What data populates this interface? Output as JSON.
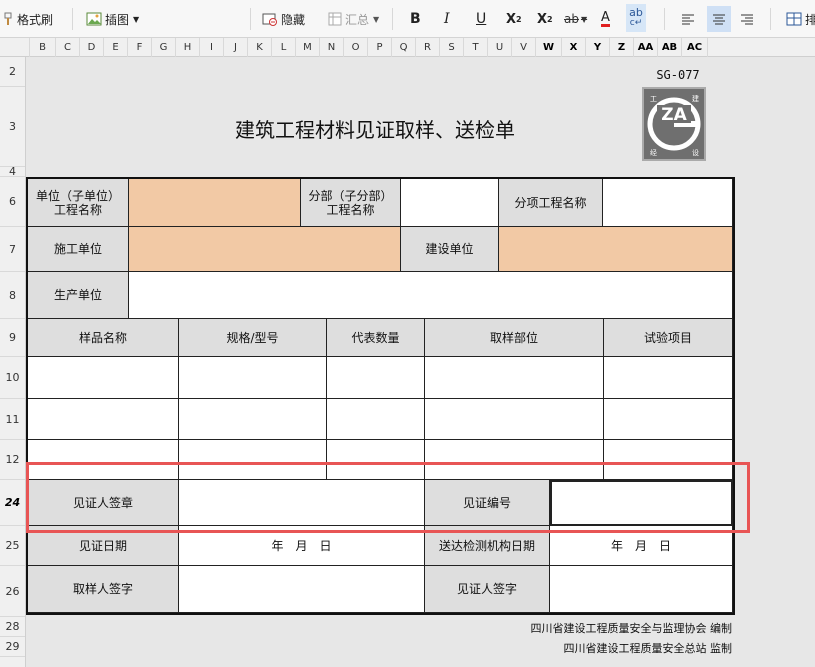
{
  "toolbar": {
    "format_painter": "格式刷",
    "insert_image": "插图",
    "hide": "隐藏",
    "summary": "汇总",
    "bold": "B",
    "italic": "I",
    "underline": "U",
    "superscript": "X",
    "subscript": "X",
    "strike": "ab",
    "font_color": "A",
    "phonetic": "ab",
    "cut_label": "排"
  },
  "columns": [
    "B",
    "C",
    "D",
    "E",
    "F",
    "G",
    "H",
    "I",
    "J",
    "K",
    "L",
    "M",
    "N",
    "O",
    "P",
    "Q",
    "R",
    "S",
    "T",
    "U",
    "V",
    "W",
    "X",
    "Y",
    "Z",
    "AA",
    "AB",
    "AC"
  ],
  "rows": [
    "2",
    "3",
    "4",
    "6",
    "7",
    "8",
    "9",
    "10",
    "11",
    "12",
    "24",
    "25",
    "26",
    "28",
    "29"
  ],
  "sheet": {
    "doc_code": "SG-077",
    "title": "建筑工程材料见证取样、送检单",
    "logo": {
      "text": "ZA",
      "corners": [
        "工",
        "建",
        "经",
        "设"
      ]
    },
    "labels": {
      "unit_name": "单位（子单位）\n工程名称",
      "sub_division": "分部（子分部）\n工程名称",
      "sub_item": "分项工程名称",
      "construction_unit": "施工单位",
      "builder_unit": "建设单位",
      "producer": "生产单位",
      "sample_name": "样品名称",
      "spec_model": "规格/型号",
      "quantity": "代表数量",
      "sample_location": "取样部位",
      "test_item": "试验项目",
      "witness_seal": "见证人签章",
      "witness_no": "见证编号",
      "witness_date": "见证日期",
      "date_placeholder": "年　月　日",
      "send_date": "送达检测机构日期",
      "date_placeholder2": "年　月　日",
      "sampler_sign": "取样人签字",
      "witness_sign": "见证人签字"
    },
    "footer1": "四川省建设工程质量安全与监理协会  编制",
    "footer2": "四川省建设工程质量安全总站  监制"
  },
  "highlight_color": "#e85555",
  "peach_color": "#f2c9a5"
}
